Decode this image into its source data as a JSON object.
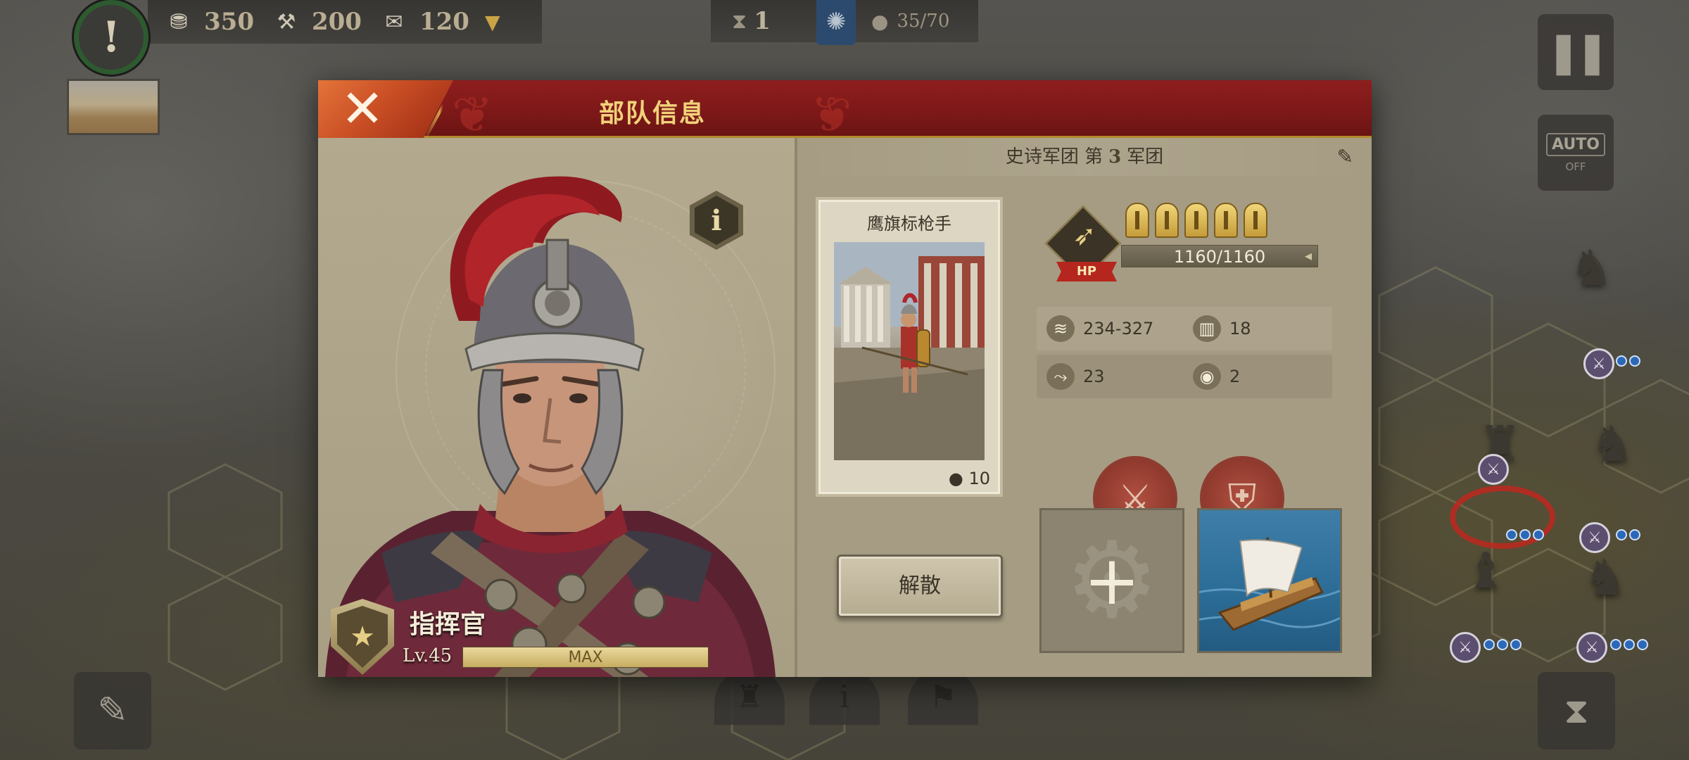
{
  "hud": {
    "resources": [
      {
        "icon": "coin-icon",
        "value": "350"
      },
      {
        "icon": "hammer-icon",
        "value": "200"
      },
      {
        "icon": "scroll-icon",
        "value": "120"
      }
    ],
    "turn": "1",
    "population": "35/70"
  },
  "side": {
    "auto_label": "AUTO",
    "auto_state": "OFF"
  },
  "dialog": {
    "title": "部队信息",
    "commander": {
      "name": "指挥官",
      "level": "Lv.45",
      "xp_label": "MAX",
      "xp_fraction": 1.0
    },
    "legion": {
      "prefix": "史诗军团 第",
      "number": "3",
      "suffix": "军团"
    },
    "unit": {
      "name": "鹰旗标枪手",
      "count": "10",
      "stars": 5,
      "hp_tag": "HP",
      "hp_text": "1160/1160",
      "hp_fraction": 1.0,
      "stats": [
        {
          "icon": "attack-icon",
          "value": "234-327"
        },
        {
          "icon": "defense-icon",
          "value": "18"
        },
        {
          "icon": "movement-icon",
          "value": "23"
        },
        {
          "icon": "vision-icon",
          "value": "2"
        }
      ]
    },
    "disband_label": "解散",
    "colors": {
      "header": "#7d1818",
      "title_gold": "#f1d27a",
      "hp_red": "#b5261e"
    }
  }
}
